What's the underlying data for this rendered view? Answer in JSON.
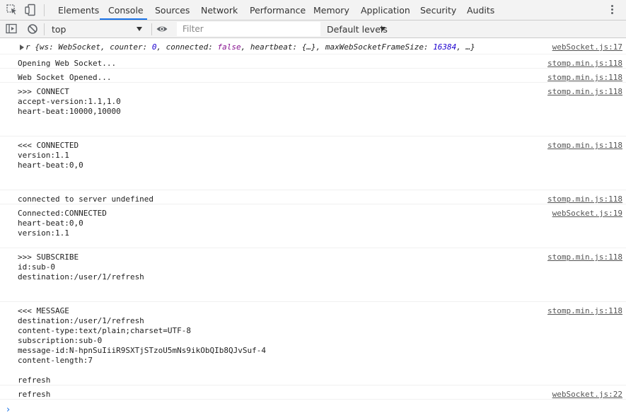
{
  "tabs": [
    {
      "label": "Elements"
    },
    {
      "label": "Console"
    },
    {
      "label": "Sources"
    },
    {
      "label": "Network"
    },
    {
      "label": "Performance"
    },
    {
      "label": "Memory"
    },
    {
      "label": "Application"
    },
    {
      "label": "Security"
    },
    {
      "label": "Audits"
    }
  ],
  "active_tab": "Console",
  "accent_color": "#1a73e8",
  "toolbar": {
    "context": "top",
    "filter_placeholder": "Filter",
    "levels": "Default levels"
  },
  "object_log": {
    "prefix": "r {ws: WebSocket, counter: ",
    "counter": "0",
    "mid1": ", connected: ",
    "connected": "false",
    "mid2": ", heartbeat: {…}, maxWebSocketFrameSize: ",
    "frame_size": "16384",
    "suffix": ", …}",
    "source": "webSocket.js:17"
  },
  "messages": [
    {
      "text": "Opening Web Socket...",
      "source": "stomp.min.js:118"
    },
    {
      "text": "Web Socket Opened...",
      "source": "stomp.min.js:118"
    },
    {
      "text": ">>> CONNECT\naccept-version:1.1,1.0\nheart-beat:10000,10000",
      "source": "stomp.min.js:118"
    },
    {
      "text": "<<< CONNECTED\nversion:1.1\nheart-beat:0,0",
      "source": "stomp.min.js:118"
    },
    {
      "text": "connected to server undefined",
      "source": "stomp.min.js:118"
    },
    {
      "text": "Connected:CONNECTED\nheart-beat:0,0\nversion:1.1",
      "source": "webSocket.js:19"
    },
    {
      "text": ">>> SUBSCRIBE\nid:sub-0\ndestination:/user/1/refresh",
      "source": "stomp.min.js:118"
    },
    {
      "text": "<<< MESSAGE\ndestination:/user/1/refresh\ncontent-type:text/plain;charset=UTF-8\nsubscription:sub-0\nmessage-id:N-hpnSuIiiR9SXTjSTzoU5mNs9ikObQIb8QJvSuf-4\ncontent-length:7\n\nrefresh",
      "source": "stomp.min.js:118"
    },
    {
      "text": "refresh",
      "source": "webSocket.js:22"
    }
  ],
  "prompt_symbol": "›"
}
